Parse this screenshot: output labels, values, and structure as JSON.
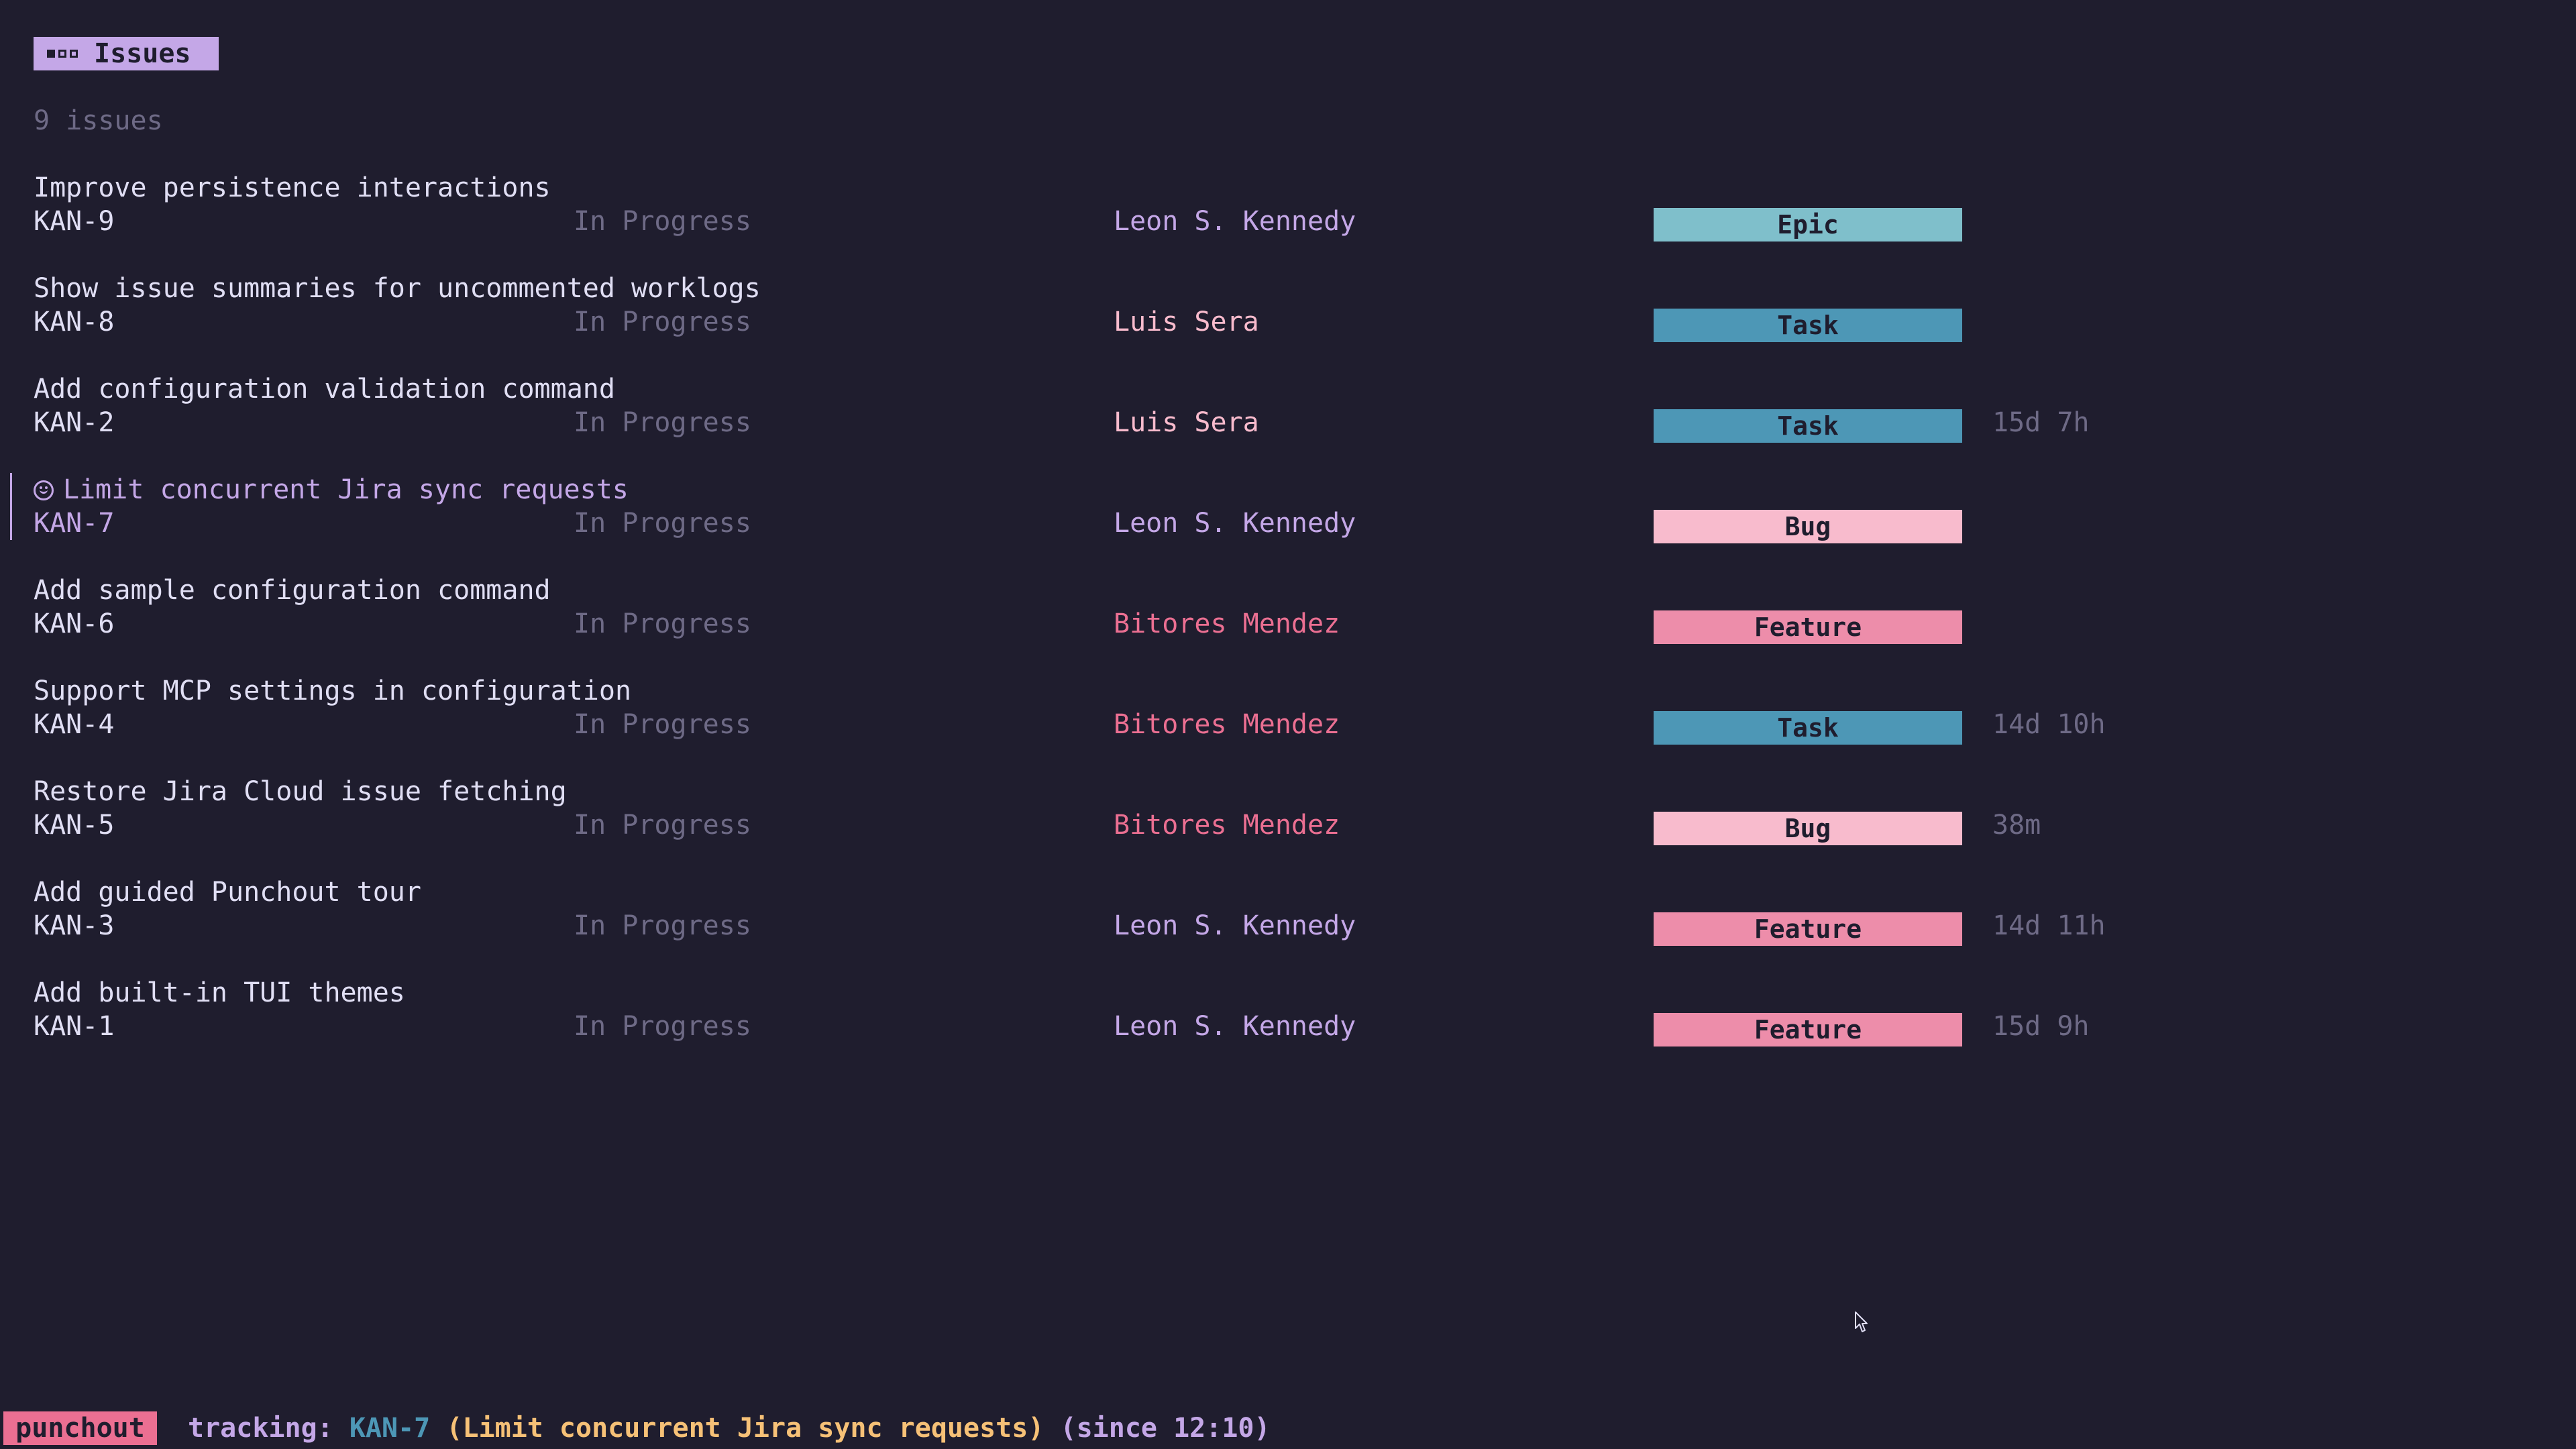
{
  "header": {
    "title": "Issues"
  },
  "summary": {
    "count_label": "9 issues"
  },
  "colors": {
    "epic": "#7fbfcb",
    "task": "#4d97b6",
    "bug": "#f8bbcd",
    "feature": "#ed8daa",
    "assignee_leon": "#c4a7e7",
    "assignee_luis": "#f8bbcd",
    "assignee_bitores": "#eb6f92"
  },
  "issues": [
    {
      "title": "Improve persistence interactions",
      "key": "KAN-9",
      "status": "In Progress",
      "assignee": "Leon S. Kennedy",
      "assignee_color": "#c4a7e7",
      "type": "Epic",
      "type_color": "#7fbfcb",
      "logged": ""
    },
    {
      "title": "Show issue summaries for uncommented worklogs",
      "key": "KAN-8",
      "status": "In Progress",
      "assignee": "Luis Sera",
      "assignee_color": "#f8bbcd",
      "type": "Task",
      "type_color": "#4d97b6",
      "logged": ""
    },
    {
      "title": "Add configuration validation command",
      "key": "KAN-2",
      "status": "In Progress",
      "assignee": "Luis Sera",
      "assignee_color": "#f8bbcd",
      "type": "Task",
      "type_color": "#4d97b6",
      "logged": "15d 7h"
    },
    {
      "title": "Limit concurrent Jira sync requests",
      "key": "KAN-7",
      "status": "In Progress",
      "assignee": "Leon S. Kennedy",
      "assignee_color": "#c4a7e7",
      "type": "Bug",
      "type_color": "#f8bbcd",
      "logged": "",
      "selected": true,
      "icon": "smiley-icon"
    },
    {
      "title": "Add sample configuration command",
      "key": "KAN-6",
      "status": "In Progress",
      "assignee": "Bitores Mendez",
      "assignee_color": "#eb6f92",
      "type": "Feature",
      "type_color": "#ed8daa",
      "logged": ""
    },
    {
      "title": "Support MCP settings in configuration",
      "key": "KAN-4",
      "status": "In Progress",
      "assignee": "Bitores Mendez",
      "assignee_color": "#eb6f92",
      "type": "Task",
      "type_color": "#4d97b6",
      "logged": "14d 10h"
    },
    {
      "title": "Restore Jira Cloud issue fetching",
      "key": "KAN-5",
      "status": "In Progress",
      "assignee": "Bitores Mendez",
      "assignee_color": "#eb6f92",
      "type": "Bug",
      "type_color": "#f8bbcd",
      "logged": "38m"
    },
    {
      "title": "Add guided Punchout tour",
      "key": "KAN-3",
      "status": "In Progress",
      "assignee": "Leon S. Kennedy",
      "assignee_color": "#c4a7e7",
      "type": "Feature",
      "type_color": "#ed8daa",
      "logged": "14d 11h"
    },
    {
      "title": "Add built-in TUI themes",
      "key": "KAN-1",
      "status": "In Progress",
      "assignee": "Leon S. Kennedy",
      "assignee_color": "#c4a7e7",
      "type": "Feature",
      "type_color": "#ed8daa",
      "logged": "15d 9h"
    }
  ],
  "statusbar": {
    "app_name": "punchout",
    "tracking_label": "tracking:",
    "tracking_key": "KAN-7",
    "tracking_title": "(Limit concurrent Jira sync requests)",
    "tracking_since": "(since 12:10)"
  }
}
